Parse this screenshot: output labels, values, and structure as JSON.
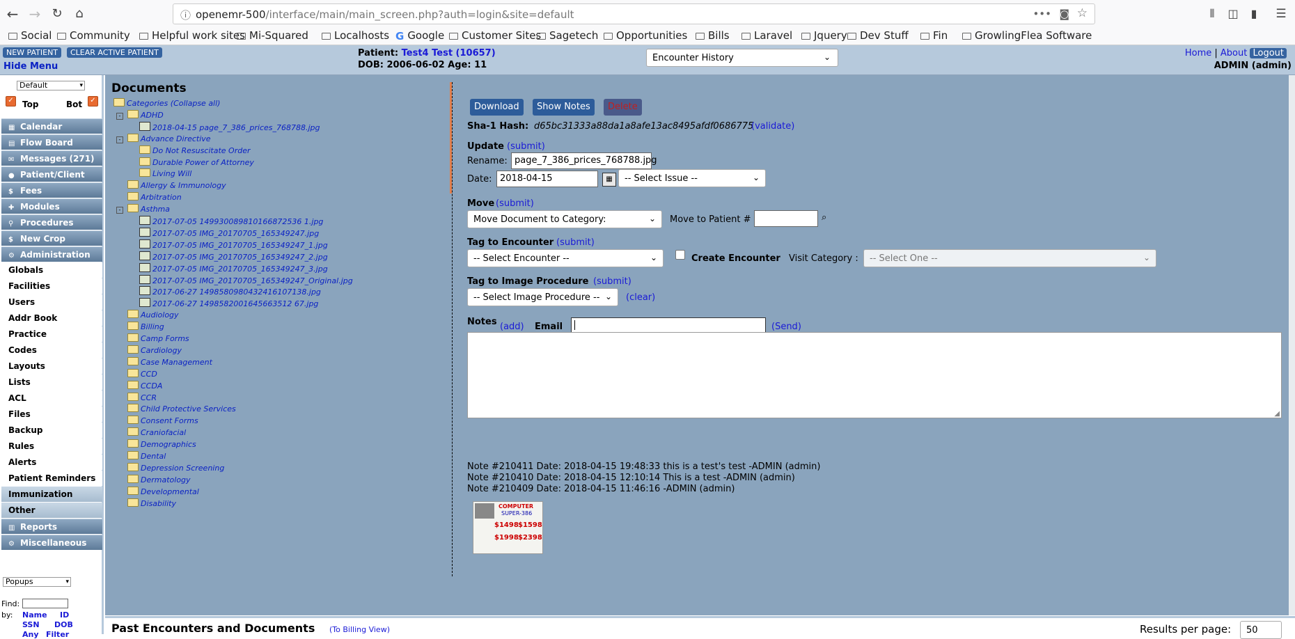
{
  "browser": {
    "url_host": "openemr-500",
    "url_path": "/interface/main/main_screen.php?auth=login&site=default",
    "bookmarks": [
      "Social",
      "Community",
      "Helpful work sites",
      "Mi-Squared",
      "Localhosts",
      "Google",
      "Customer Sites",
      "Sagetech",
      "Opportunities",
      "Bills",
      "Laravel",
      "Jquery",
      "Dev Stuff",
      "Fin",
      "GrowlingFlea Software"
    ]
  },
  "header": {
    "new_patient": "NEW PATIENT",
    "clear_patient": "CLEAR ACTIVE PATIENT",
    "hide_menu": "Hide Menu",
    "patient_label": "Patient:",
    "patient_name": "Test4 Test (10657)",
    "dob": "DOB: 2006-06-02 Age: 11",
    "encounter_select": "Encounter History",
    "home": "Home",
    "sep": "|",
    "about": "About",
    "logout": "Logout",
    "user": "ADMIN (admin)"
  },
  "leftnav": {
    "layout_select": "Default",
    "top": "Top",
    "bot": "Bot",
    "items": [
      {
        "label": "Calendar",
        "style": "dark",
        "icon": "▦"
      },
      {
        "label": "Flow Board",
        "style": "dark",
        "icon": "▤"
      },
      {
        "label": "Messages (271)",
        "style": "dark",
        "icon": "✉"
      },
      {
        "label": "Patient/Client",
        "style": "dark",
        "icon": "●"
      },
      {
        "label": "Fees",
        "style": "dark",
        "icon": "$"
      },
      {
        "label": "Modules",
        "style": "dark",
        "icon": "✚"
      },
      {
        "label": "Procedures",
        "style": "dark",
        "icon": "⚲"
      },
      {
        "label": "New Crop",
        "style": "dark",
        "icon": "$"
      },
      {
        "label": "Administration",
        "style": "dark",
        "icon": "⚙"
      },
      {
        "label": "Globals",
        "style": "plain",
        "icon": ""
      },
      {
        "label": "Facilities",
        "style": "plain",
        "icon": ""
      },
      {
        "label": "Users",
        "style": "plain",
        "icon": ""
      },
      {
        "label": "Addr Book",
        "style": "plain",
        "icon": ""
      },
      {
        "label": "Practice",
        "style": "plain",
        "icon": ""
      },
      {
        "label": "Codes",
        "style": "plain",
        "icon": ""
      },
      {
        "label": "Layouts",
        "style": "plain",
        "icon": ""
      },
      {
        "label": "Lists",
        "style": "plain",
        "icon": ""
      },
      {
        "label": "ACL",
        "style": "plain",
        "icon": ""
      },
      {
        "label": "Files",
        "style": "plain",
        "icon": ""
      },
      {
        "label": "Backup",
        "style": "plain",
        "icon": ""
      },
      {
        "label": "Rules",
        "style": "plain",
        "icon": ""
      },
      {
        "label": "Alerts",
        "style": "plain",
        "icon": ""
      },
      {
        "label": "Patient Reminders",
        "style": "plain",
        "icon": ""
      },
      {
        "label": "Immunization",
        "style": "light",
        "icon": ""
      },
      {
        "label": "Other",
        "style": "light",
        "icon": ""
      },
      {
        "label": "Reports",
        "style": "dark",
        "icon": "▥"
      },
      {
        "label": "Miscellaneous",
        "style": "dark",
        "icon": "⚙"
      }
    ],
    "popups_select": "Popups",
    "find": "Find:",
    "by": "by:",
    "by_name": "Name",
    "by_id": "ID",
    "by_ssn": "SSN",
    "by_dob": "DOB",
    "by_any": "Any",
    "by_filter": "Filter"
  },
  "documents": {
    "title": "Documents",
    "tree": [
      {
        "text": "Categories (Collapse all)",
        "kind": "folder",
        "indent": 0,
        "exp": ""
      },
      {
        "text": "ADHD",
        "kind": "folder",
        "indent": 1,
        "exp": "-"
      },
      {
        "text": "2018-04-15 page_7_386_prices_768788.jpg",
        "kind": "image",
        "indent": 2,
        "exp": ""
      },
      {
        "text": "Advance Directive",
        "kind": "folder",
        "indent": 1,
        "exp": "-"
      },
      {
        "text": "Do Not Resuscitate Order",
        "kind": "folder",
        "indent": 2,
        "exp": ""
      },
      {
        "text": "Durable Power of Attorney",
        "kind": "folder",
        "indent": 2,
        "exp": ""
      },
      {
        "text": "Living Will",
        "kind": "folder",
        "indent": 2,
        "exp": ""
      },
      {
        "text": "Allergy & Immunology",
        "kind": "folder",
        "indent": 1,
        "exp": ""
      },
      {
        "text": "Arbitration",
        "kind": "folder",
        "indent": 1,
        "exp": ""
      },
      {
        "text": "Asthma",
        "kind": "folder",
        "indent": 1,
        "exp": "-"
      },
      {
        "text": "2017-07-05 149930089810166872536 1.jpg",
        "kind": "image",
        "indent": 2,
        "exp": ""
      },
      {
        "text": "2017-07-05 IMG_20170705_165349247.jpg",
        "kind": "image",
        "indent": 2,
        "exp": ""
      },
      {
        "text": "2017-07-05 IMG_20170705_165349247_1.jpg",
        "kind": "image",
        "indent": 2,
        "exp": ""
      },
      {
        "text": "2017-07-05 IMG_20170705_165349247_2.jpg",
        "kind": "image",
        "indent": 2,
        "exp": ""
      },
      {
        "text": "2017-07-05 IMG_20170705_165349247_3.jpg",
        "kind": "image",
        "indent": 2,
        "exp": ""
      },
      {
        "text": "2017-07-05 IMG_20170705_165349247_Original.jpg",
        "kind": "image",
        "indent": 2,
        "exp": ""
      },
      {
        "text": "2017-06-27 1498580980432416107138.jpg",
        "kind": "image",
        "indent": 2,
        "exp": ""
      },
      {
        "text": "2017-06-27 1498582001645663512 67.jpg",
        "kind": "image",
        "indent": 2,
        "exp": ""
      },
      {
        "text": "Audiology",
        "kind": "folder",
        "indent": 1,
        "exp": ""
      },
      {
        "text": "Billing",
        "kind": "folder",
        "indent": 1,
        "exp": ""
      },
      {
        "text": "Camp Forms",
        "kind": "folder",
        "indent": 1,
        "exp": ""
      },
      {
        "text": "Cardiology",
        "kind": "folder",
        "indent": 1,
        "exp": ""
      },
      {
        "text": "Case Management",
        "kind": "folder",
        "indent": 1,
        "exp": ""
      },
      {
        "text": "CCD",
        "kind": "folder",
        "indent": 1,
        "exp": ""
      },
      {
        "text": "CCDA",
        "kind": "folder",
        "indent": 1,
        "exp": ""
      },
      {
        "text": "CCR",
        "kind": "folder",
        "indent": 1,
        "exp": ""
      },
      {
        "text": "Child Protective Services",
        "kind": "folder",
        "indent": 1,
        "exp": ""
      },
      {
        "text": "Consent Forms",
        "kind": "folder",
        "indent": 1,
        "exp": ""
      },
      {
        "text": "Craniofacial",
        "kind": "folder",
        "indent": 1,
        "exp": ""
      },
      {
        "text": "Demographics",
        "kind": "folder",
        "indent": 1,
        "exp": ""
      },
      {
        "text": "Dental",
        "kind": "folder",
        "indent": 1,
        "exp": ""
      },
      {
        "text": "Depression Screening",
        "kind": "folder",
        "indent": 1,
        "exp": ""
      },
      {
        "text": "Dermatology",
        "kind": "folder",
        "indent": 1,
        "exp": ""
      },
      {
        "text": "Developmental",
        "kind": "folder",
        "indent": 1,
        "exp": ""
      },
      {
        "text": "Disability",
        "kind": "folder",
        "indent": 1,
        "exp": ""
      }
    ]
  },
  "detail": {
    "download": "Download",
    "show_notes": "Show Notes",
    "delete": "Delete",
    "sha_label": "Sha-1 Hash:",
    "sha_value": "d65bc31333a88da1a8afe13ac8495afdf0686775",
    "validate": "(validate)",
    "update": "Update",
    "submit": "(submit)",
    "rename_label": "Rename:",
    "rename_value": "page_7_386_prices_768788.jpg",
    "date_label": "Date:",
    "date_value": "2018-04-15",
    "select_issue": "-- Select Issue --",
    "move": "Move",
    "move_category": "Move Document to Category:",
    "move_patient": "Move to Patient #",
    "tag_encounter": "Tag to Encounter",
    "select_encounter": "-- Select Encounter --",
    "create_encounter": "Create Encounter",
    "visit_category": "Visit Category :",
    "select_one": "-- Select One --",
    "tag_image": "Tag to Image Procedure",
    "select_image": "-- Select Image Procedure --",
    "clear": "(clear)",
    "notes": "Notes",
    "add": "(add)",
    "email": "Email",
    "send": "(Send)",
    "note_list": [
      "Note #210411 Date: 2018-04-15 19:48:33 this is a test's test  -ADMIN (admin)",
      "Note #210410 Date: 2018-04-15 12:10:14 This is a test  -ADMIN (admin)",
      "Note #210409 Date: 2018-04-15 11:46:16  -ADMIN (admin)"
    ],
    "thumb_title": "COMPUTER",
    "thumb_sub": "SUPER-386",
    "thumb_p1": "$1498",
    "thumb_p2": "$1598",
    "thumb_p3": "$1998",
    "thumb_p4": "$2398"
  },
  "footer": {
    "title": "Past Encounters and Documents",
    "billing_view": "(To Billing View)",
    "results": "Results per page:",
    "results_value": "50"
  }
}
